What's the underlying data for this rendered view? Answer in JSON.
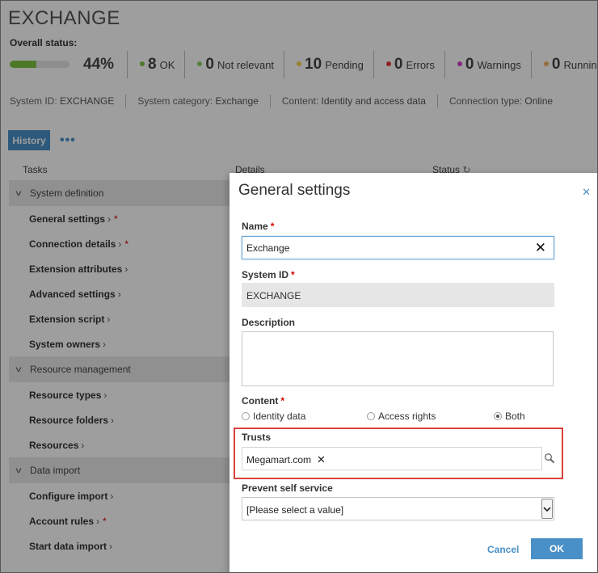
{
  "page": {
    "title": "EXCHANGE",
    "overall_status_label": "Overall status:",
    "progress": {
      "percent_label": "44%",
      "fill_fraction": 0.44
    },
    "counters": [
      {
        "value": "8",
        "label": "OK",
        "color": "#7cc242"
      },
      {
        "value": "0",
        "label": "Not relevant",
        "color": "#8fcf6a"
      },
      {
        "value": "10",
        "label": "Pending",
        "color": "#f2d34a"
      },
      {
        "value": "0",
        "label": "Errors",
        "color": "#e53935"
      },
      {
        "value": "0",
        "label": "Warnings",
        "color": "#d640c8"
      },
      {
        "value": "0",
        "label": "Running",
        "color": "#f0b060"
      }
    ],
    "meta": [
      {
        "key": "System ID:",
        "value": "EXCHANGE"
      },
      {
        "key": "System category:",
        "value": "Exchange"
      },
      {
        "key": "Content:",
        "value": "Identity and access data"
      },
      {
        "key": "Connection type:",
        "value": "Online"
      }
    ],
    "history_button": "History",
    "more_icon": "more-dots-icon",
    "columns": {
      "tasks": "Tasks",
      "details": "Details",
      "status": "Status"
    },
    "groups": [
      {
        "label": "System definition",
        "items": [
          {
            "label": "General settings",
            "required": "*"
          },
          {
            "label": "Connection details",
            "required": "*"
          },
          {
            "label": "Extension attributes",
            "required": ""
          },
          {
            "label": "Advanced settings",
            "required": ""
          },
          {
            "label": "Extension script",
            "required": ""
          },
          {
            "label": "System owners",
            "required": ""
          }
        ]
      },
      {
        "label": "Resource management",
        "items": [
          {
            "label": "Resource types",
            "required": ""
          },
          {
            "label": "Resource folders",
            "required": ""
          },
          {
            "label": "Resources",
            "required": ""
          }
        ]
      },
      {
        "label": "Data import",
        "items": [
          {
            "label": "Configure import",
            "required": ""
          },
          {
            "label": "Account rules",
            "required": "*"
          },
          {
            "label": "Start data import",
            "required": ""
          }
        ]
      }
    ]
  },
  "dialog": {
    "title": "General settings",
    "close_icon": "close-icon",
    "name_label": "Name",
    "name_value": "Exchange",
    "system_id_label": "System ID",
    "system_id_value": "EXCHANGE",
    "description_label": "Description",
    "content_label": "Content",
    "required_mark": "*",
    "content_options": [
      {
        "label": "Identity data",
        "selected": false
      },
      {
        "label": "Access rights",
        "selected": false
      },
      {
        "label": "Both",
        "selected": true
      }
    ],
    "trusts_label": "Trusts",
    "trusts_value": "Megamart.com",
    "prevent_label": "Prevent self service",
    "prevent_value": "[Please select a value]",
    "cancel_label": "Cancel",
    "ok_label": "OK",
    "highlight_color": "#d9413b",
    "accent_color": "#4a90c8"
  }
}
